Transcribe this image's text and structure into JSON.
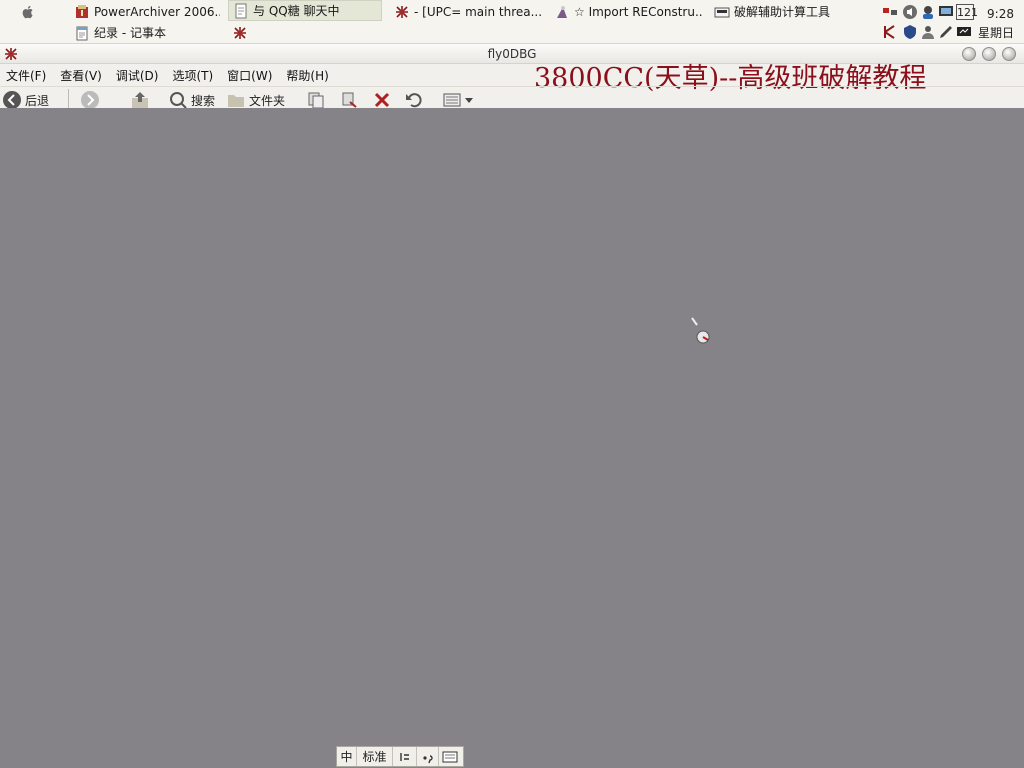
{
  "taskbar": {
    "tasks_row1": [
      {
        "label": "PowerArchiver 2006...",
        "icon": "archive-icon",
        "active": false
      },
      {
        "label": "与 QQ糖 聊天中",
        "icon": "chat-window-icon",
        "active": true
      },
      {
        "label": "- [UPC=  main threa...",
        "icon": "debugger-bug-icon",
        "active": false
      },
      {
        "label": "☆ Import REConstru...",
        "icon": "import-reconstructor-icon",
        "active": false
      },
      {
        "label": "破解辅助计算工具",
        "icon": "calculator-tool-icon",
        "active": false
      }
    ],
    "tasks_row2": [
      {
        "label": "纪录 - 记事本",
        "icon": "notepad-icon",
        "active": false
      },
      {
        "label": "",
        "icon": "debugger-bug-icon",
        "active": false
      }
    ],
    "tray_badge": "121",
    "clock": {
      "time": "9:28",
      "weekday": "星期日"
    }
  },
  "window": {
    "title": "fly0DBG",
    "menu": [
      "文件(F)",
      "查看(V)",
      "调试(D)",
      "选项(T)",
      "窗口(W)",
      "帮助(H)"
    ],
    "watermark": "3800CC(天草)--高级班破解教程",
    "toolbar": [
      {
        "label": "后退",
        "icon": "back-icon"
      },
      {
        "label": "",
        "icon": "forward-icon"
      },
      {
        "label": "",
        "icon": "up-folder-icon"
      },
      {
        "label": "搜索",
        "icon": "search-icon"
      },
      {
        "label": "文件夹",
        "icon": "folders-icon"
      },
      {
        "label": "",
        "icon": "copy-to-icon"
      },
      {
        "label": "",
        "icon": "move-to-icon"
      },
      {
        "label": "",
        "icon": "delete-icon"
      },
      {
        "label": "",
        "icon": "undo-icon"
      },
      {
        "label": "",
        "icon": "views-icon"
      }
    ]
  },
  "ime": {
    "items": [
      "中",
      "标准",
      "",
      "",
      ""
    ]
  },
  "colors": {
    "desktop": "#858387",
    "watermark": "#8b0f1a",
    "active_task": "#e4e6d6"
  }
}
